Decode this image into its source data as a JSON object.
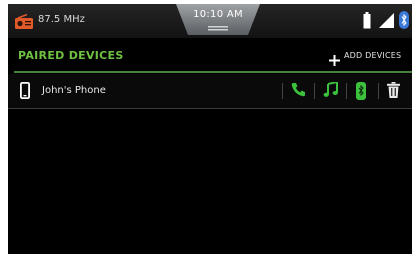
{
  "status_bar": {
    "radio_frequency": "87.5 MHz",
    "clock": "10:10 AM",
    "icons": {
      "radio": "radio-icon",
      "battery": "battery-icon",
      "signal": "signal-icon",
      "bluetooth": "bluetooth-icon"
    }
  },
  "header": {
    "title": "PAIRED DEVICES",
    "add_devices_label": "ADD DEVICES"
  },
  "devices": [
    {
      "name": "John's Phone",
      "actions": [
        "phone-icon",
        "music-icon",
        "bluetooth-battery-icon",
        "trash-icon"
      ]
    }
  ],
  "colors": {
    "accent_green": "#6fc043",
    "radio_icon_orange": "#e25a2a",
    "bluetooth_blue": "#3a78d8",
    "background": "#000000",
    "text": "#e8e8e8"
  }
}
